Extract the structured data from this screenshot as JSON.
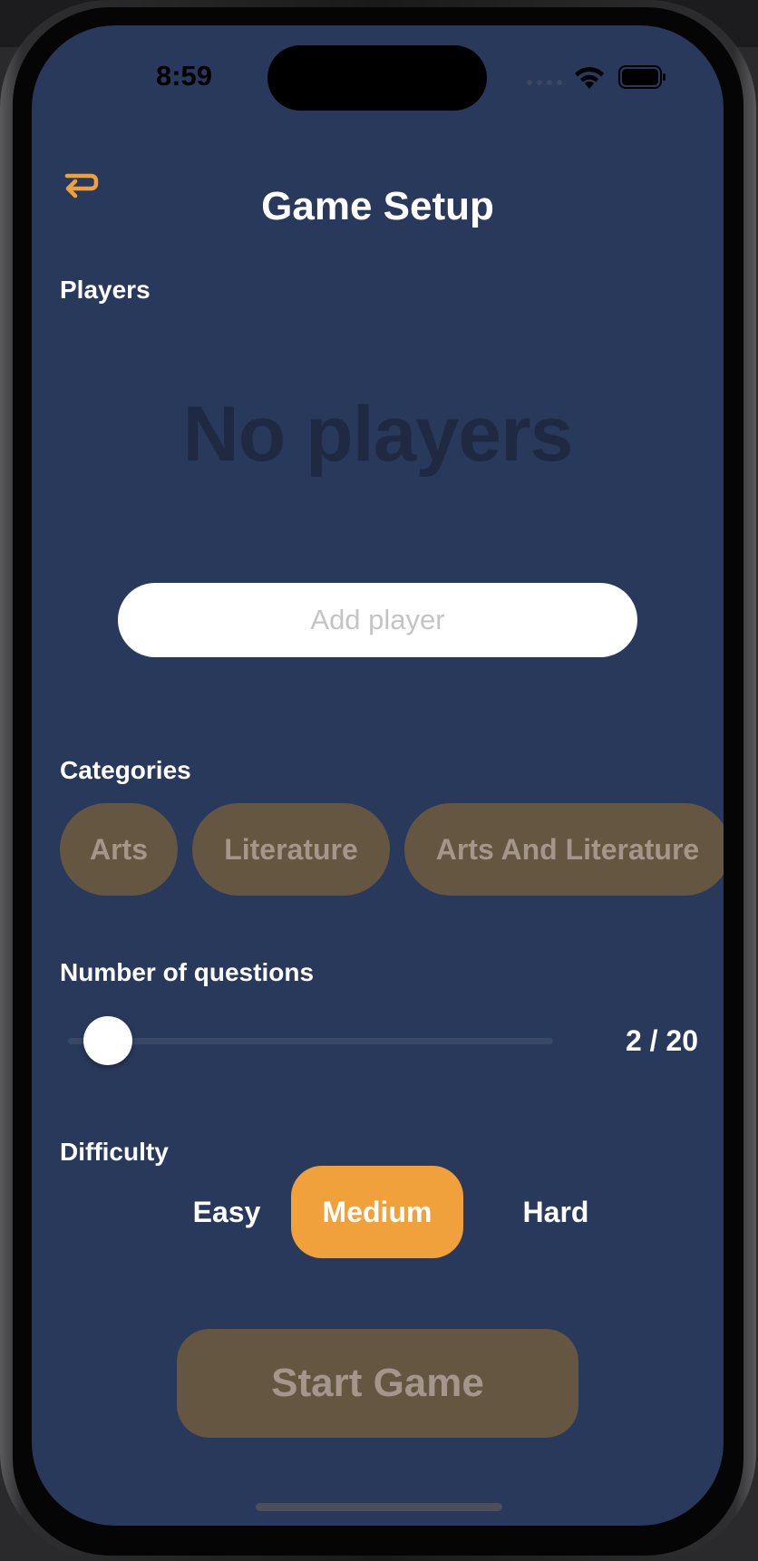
{
  "status_bar": {
    "time": "8:59"
  },
  "header": {
    "back_icon": "return-arrow-icon",
    "title": "Game Setup"
  },
  "players": {
    "label": "Players",
    "empty_text": "No players",
    "add_placeholder": "Add player",
    "add_value": ""
  },
  "categories": {
    "label": "Categories",
    "items": [
      "Arts",
      "Literature",
      "Arts And Literature"
    ]
  },
  "questions": {
    "label": "Number of questions",
    "value": 2,
    "max": 20,
    "value_text": "2 / 20"
  },
  "difficulty": {
    "label": "Difficulty",
    "options": [
      "Easy",
      "Medium",
      "Hard"
    ],
    "selected": "Medium"
  },
  "start_button": {
    "label": "Start Game"
  },
  "colors": {
    "background": "#29395b",
    "accent": "#f0a13c",
    "disabled_fill": "#645640",
    "disabled_text": "#a4968a"
  }
}
